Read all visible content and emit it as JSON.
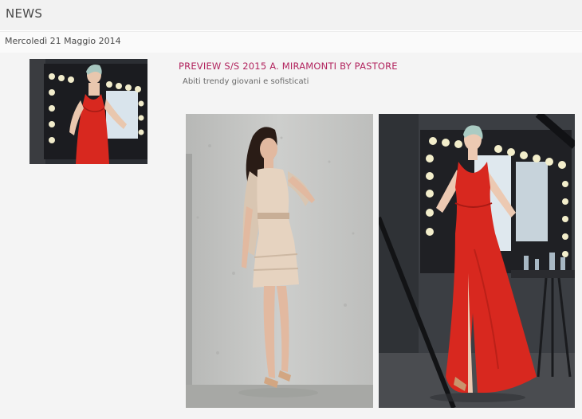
{
  "header": {
    "title": "NEWS"
  },
  "date_bar": {
    "date": "Mercoledì 21 Maggio 2014"
  },
  "article": {
    "title": "PREVIEW S/S 2015 A. MIRAMONTI BY PASTORE",
    "subtitle": "Abiti trendy giovani e sofisticati"
  },
  "colors": {
    "title_accent": "#b2245e",
    "dress_red": "#d8281f",
    "header_bg": "#f2f2f2"
  }
}
